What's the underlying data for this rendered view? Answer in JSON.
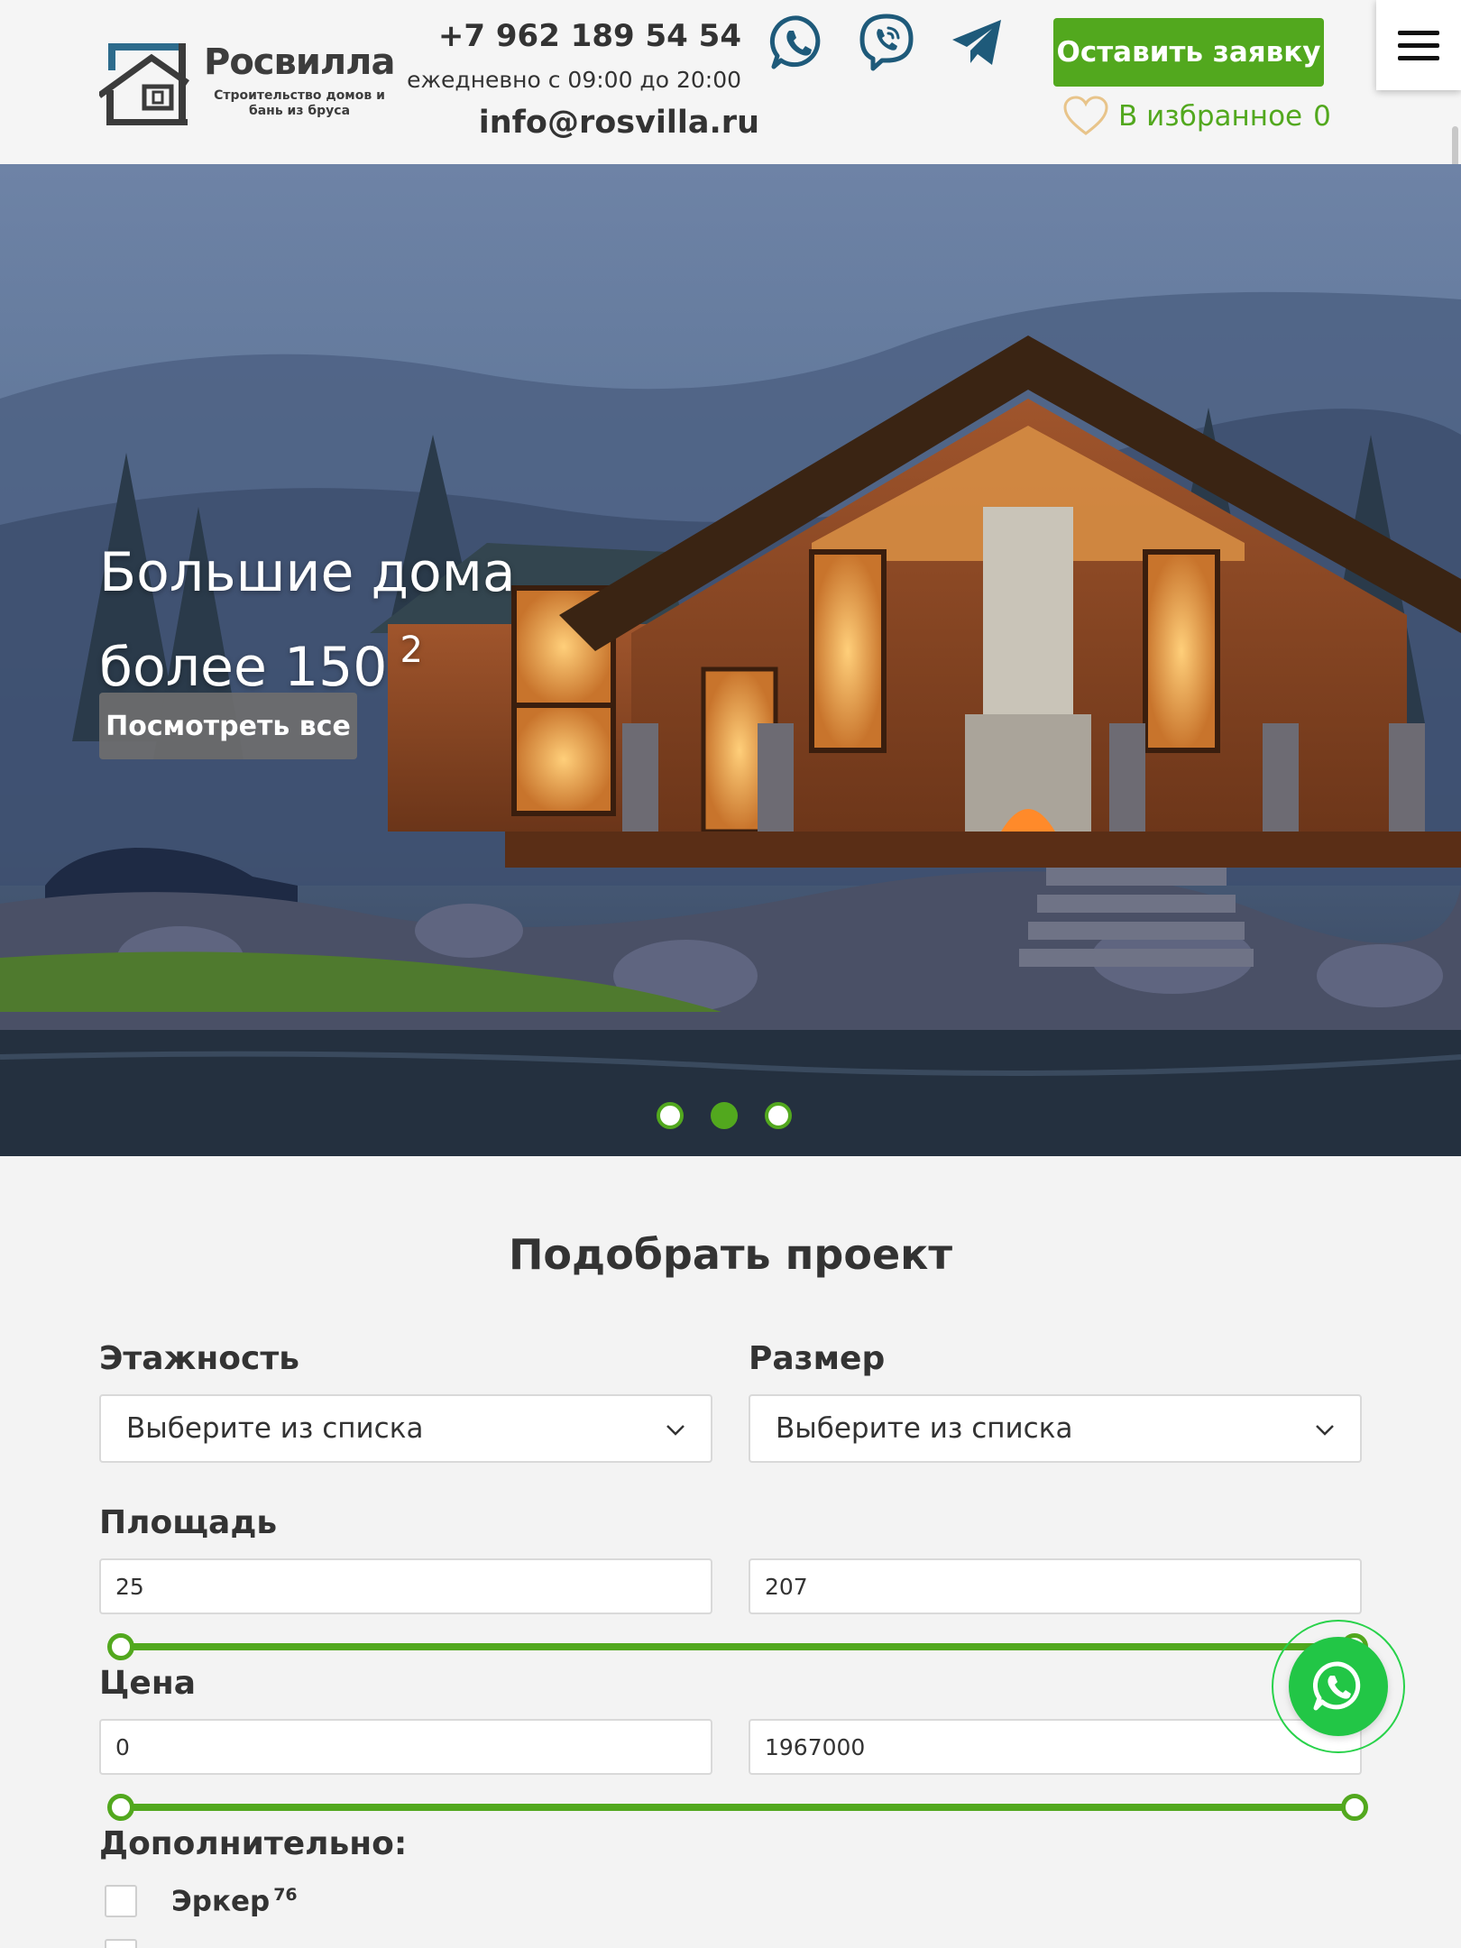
{
  "header": {
    "logo_name": "Росвилла",
    "logo_subtitle": "Строительство домов и бань из бруса",
    "phone": "+7 962 189 54 54",
    "hours": "ежедневно с 09:00 до 20:00",
    "email": "info@rosvilla.ru",
    "request_button": "Оставить заявку",
    "favorites_label": "В избранное",
    "favorites_count": "0",
    "social_icons": [
      "whatsapp-icon",
      "viber-icon",
      "telegram-icon"
    ],
    "menu_icon": "hamburger-menu-icon"
  },
  "hero": {
    "title_line1": "Большие дома",
    "title_line2": "более 150",
    "title_superscript": "2",
    "button": "Посмотреть все",
    "slides_total": 3,
    "active_slide": 2
  },
  "filter": {
    "title": "Подобрать проект",
    "floors": {
      "label": "Этажность",
      "value": "Выберите из списка"
    },
    "size": {
      "label": "Размер",
      "value": "Выберите из списка"
    },
    "area": {
      "label": "Площадь",
      "min": "25",
      "max": "207"
    },
    "price": {
      "label": "Цена",
      "min": "0",
      "max": "1967000"
    },
    "extra": {
      "label": "Дополнительно:",
      "options": [
        {
          "label": "Эркер",
          "count": "76"
        }
      ]
    }
  },
  "colors": {
    "accent": "#52a81e",
    "whatsapp": "#22c646",
    "text": "#333333",
    "background": "#f3f3f3"
  }
}
